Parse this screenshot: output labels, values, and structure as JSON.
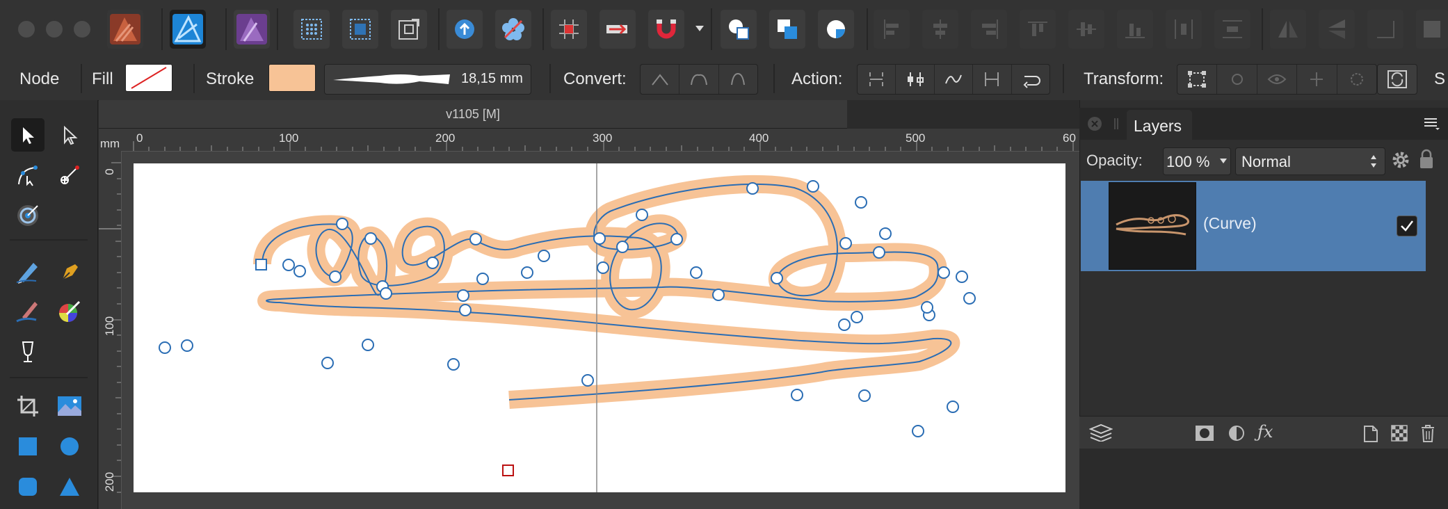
{
  "toolbar": {
    "traffic_lights": [
      "close",
      "minimize",
      "zoom"
    ],
    "persona_icons": [
      "designer-persona-icon",
      "designer-vector-persona-icon",
      "photo-persona-icon"
    ],
    "buttons": [
      "grid-icon",
      "selection-grid-icon",
      "transform-origin-icon",
      "share-up-icon",
      "flower-icon",
      "grid-snap-icon",
      "move-red-icon",
      "magnet-snap-icon",
      "snap-dropdown-icon",
      "boolean-union-icon",
      "boolean-subtract-icon",
      "boolean-intersect-icon",
      "align-left-icon",
      "align-center-icon",
      "align-right-icon",
      "align-top-icon",
      "align-middle-icon",
      "align-bottom-icon",
      "flip-horizontal-icon",
      "flip-vertical-icon"
    ]
  },
  "context": {
    "mode_label": "Node",
    "fill_label": "Fill",
    "stroke_label": "Stroke",
    "stroke_color": "#f7c396",
    "stroke_width": "18,15 mm",
    "convert_label": "Convert:",
    "action_label": "Action:",
    "transform_label": "Transform:",
    "cut_label": "S"
  },
  "document": {
    "tab_title": "v1105  [M]",
    "ruler_unit": "mm",
    "h_ticks": [
      "0",
      "100",
      "200",
      "300",
      "400",
      "500",
      "60"
    ],
    "v_ticks": [
      "0",
      "100",
      "200"
    ]
  },
  "layers": {
    "title": "Layers",
    "opacity_label": "Opacity:",
    "opacity_value": "100 %",
    "blend_mode": "Normal",
    "items": [
      {
        "name": "(Curve)",
        "visible": true
      }
    ]
  },
  "colors": {
    "accent": "#2a6db4",
    "selection_row": "#4f7db0",
    "curve_stroke": "#f7c396"
  }
}
